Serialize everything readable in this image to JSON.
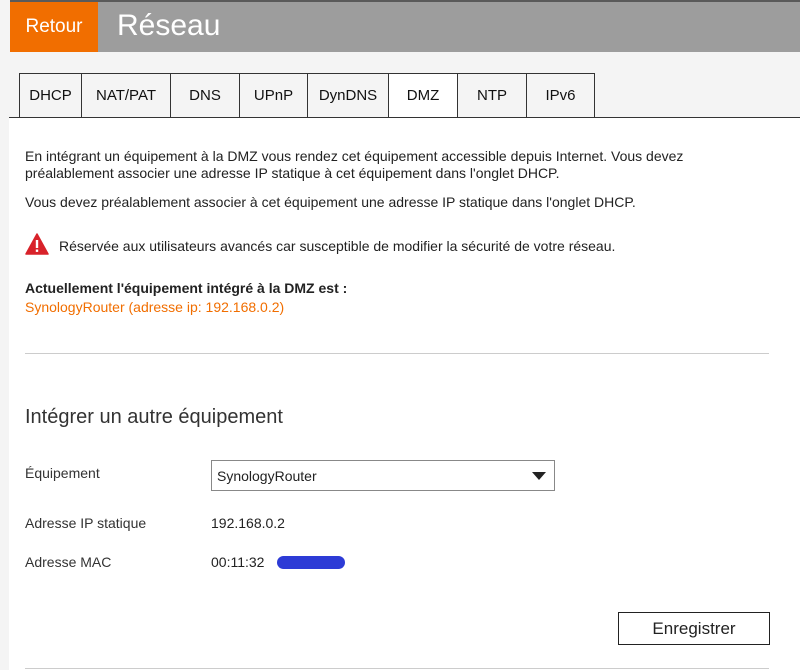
{
  "header": {
    "back_label": "Retour",
    "title": "Réseau",
    "bar_color": "#9d9d9d",
    "accent_color": "#f16e00"
  },
  "tabs": [
    {
      "label": "DHCP",
      "active": false
    },
    {
      "label": "NAT/PAT",
      "active": false
    },
    {
      "label": "DNS",
      "active": false
    },
    {
      "label": "UPnP",
      "active": false
    },
    {
      "label": "DynDNS",
      "active": false
    },
    {
      "label": "DMZ",
      "active": true
    },
    {
      "label": "NTP",
      "active": false
    },
    {
      "label": "IPv6",
      "active": false
    }
  ],
  "dmz": {
    "intro": "En intégrant un équipement à la DMZ vous rendez cet équipement accessible depuis Internet. Vous devez préalablement associer une adresse IP statique à cet équipement dans l'onglet DHCP.",
    "note": "Vous devez préalablement associer à cet équipement une adresse IP statique dans l'onglet DHCP.",
    "warning": "Réservée aux utilisateurs avancés car susceptible de modifier la sécurité de votre réseau.",
    "warning_icon": "warning-triangle-icon",
    "current_label": "Actuellement l'équipement intégré à la DMZ est :",
    "current_device": "SynologyRouter (adresse ip: 192.168.0.2)"
  },
  "form": {
    "section_title": "Intégrer un autre équipement",
    "device_label": "Équipement",
    "device_value": "SynologyRouter",
    "ip_label": "Adresse IP statique",
    "ip_value": "192.168.0.2",
    "mac_label": "Adresse MAC",
    "mac_value": "00:11:32",
    "save_label": "Enregistrer"
  }
}
